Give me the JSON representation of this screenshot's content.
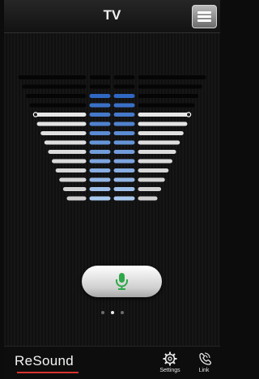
{
  "header": {
    "title": "TV"
  },
  "menu": {
    "icon": "menu-icon"
  },
  "equalizer": {
    "rows": 14,
    "selected_row": 4,
    "blue_from_row": 2,
    "colors": {
      "dark": "#050505",
      "white": "#ececec",
      "blue_top": "#2f67c2",
      "blue_bottom": "#a9c9ee",
      "handle": "#ffffff"
    }
  },
  "mic_button": {
    "icon": "microphone-icon",
    "color": "#2fa84a"
  },
  "pager": {
    "count": 3,
    "active": 1
  },
  "brand": {
    "logo_text": "ReSound",
    "accent": "#d8332d"
  },
  "tabs": [
    {
      "label": "Settings",
      "icon": "gear-icon"
    },
    {
      "label": "Link",
      "icon": "link-icon"
    }
  ]
}
